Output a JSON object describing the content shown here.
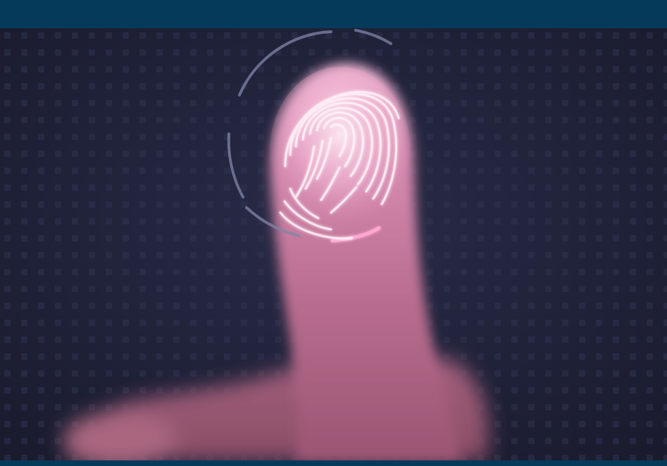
{
  "image": {
    "subject": "fingertip-scan-photo",
    "colors": {
      "frame": "#063a5a",
      "background": "#20223a",
      "finger": "#c97aa0",
      "fingerprint_glow": "#f6e6f0",
      "scan_ring": "#7f86a8",
      "scan_accent": "#ff9cc8"
    }
  }
}
